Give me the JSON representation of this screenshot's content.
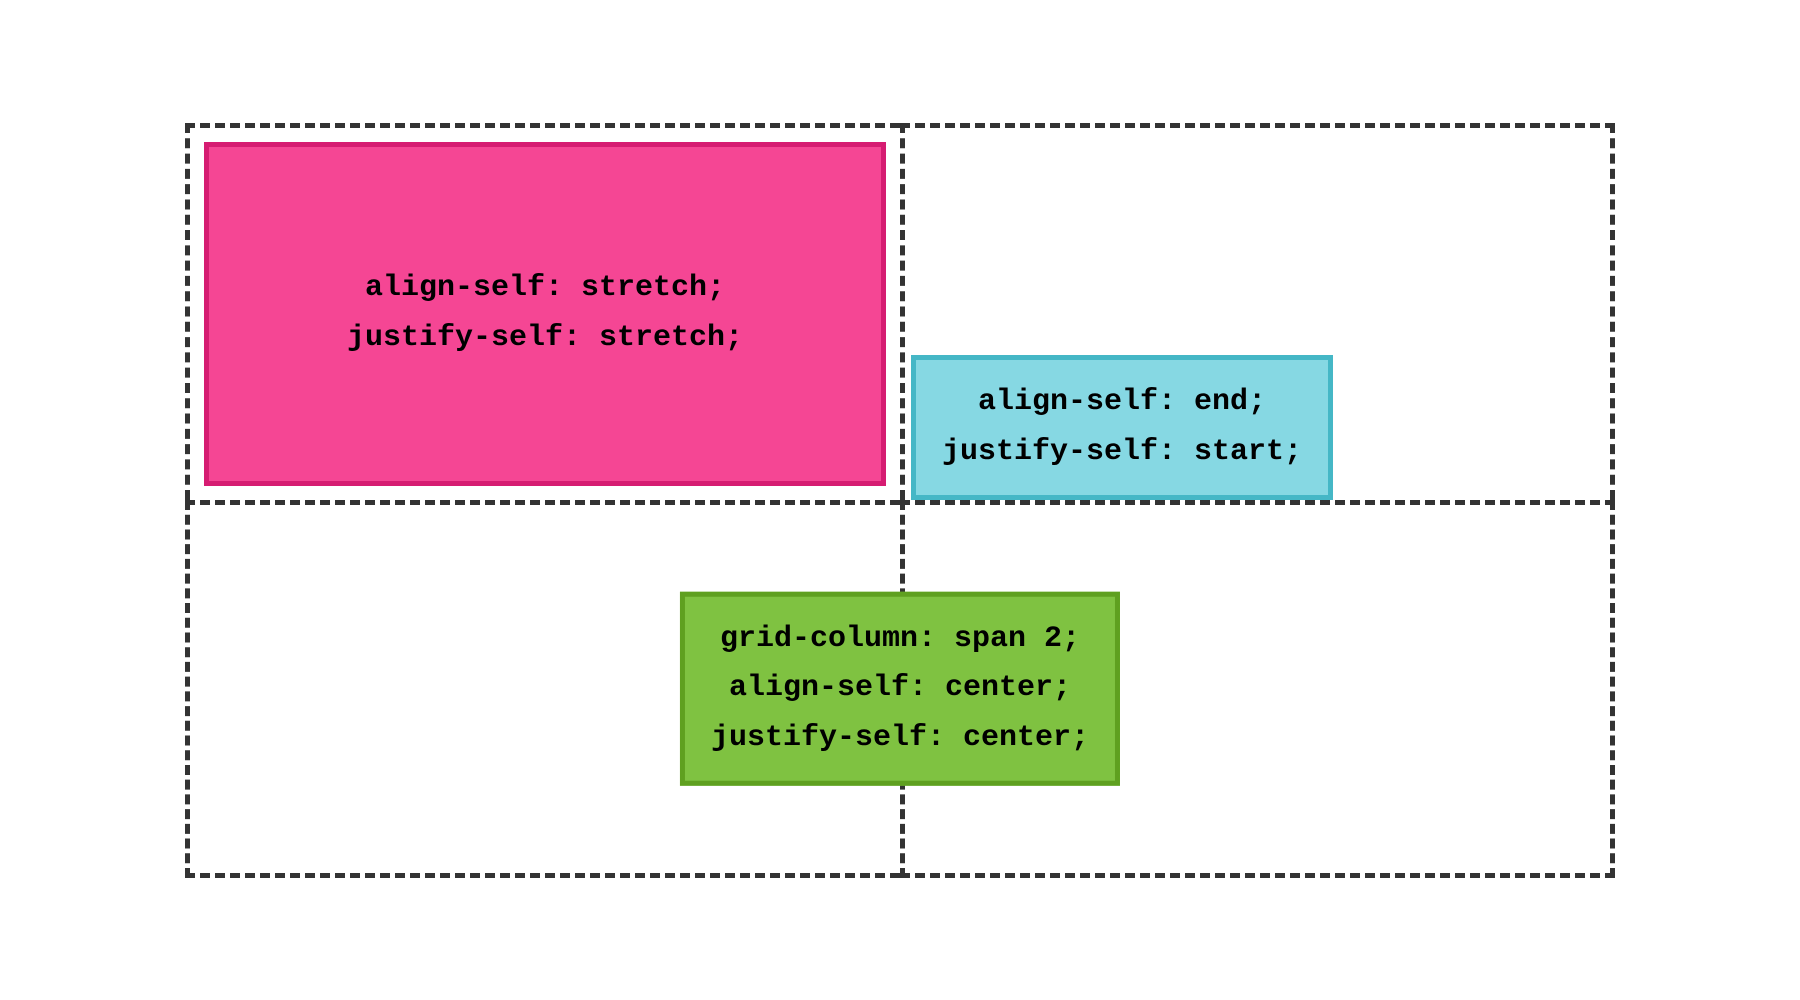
{
  "diagram": {
    "items": {
      "pink": {
        "line1": "align-self: stretch;",
        "line2": "justify-self: stretch;"
      },
      "teal": {
        "line1": "align-self: end;",
        "line2": "justify-self: start;"
      },
      "green": {
        "line1": "grid-column: span 2;",
        "line2": "align-self: center;",
        "line3": "justify-self: center;"
      }
    },
    "colors": {
      "pink_bg": "#f54694",
      "pink_border": "#d61c72",
      "teal_bg": "#86d8e3",
      "teal_border": "#45b7c6",
      "green_bg": "#7fc241",
      "green_border": "#5fa020",
      "dash": "#333333"
    }
  }
}
